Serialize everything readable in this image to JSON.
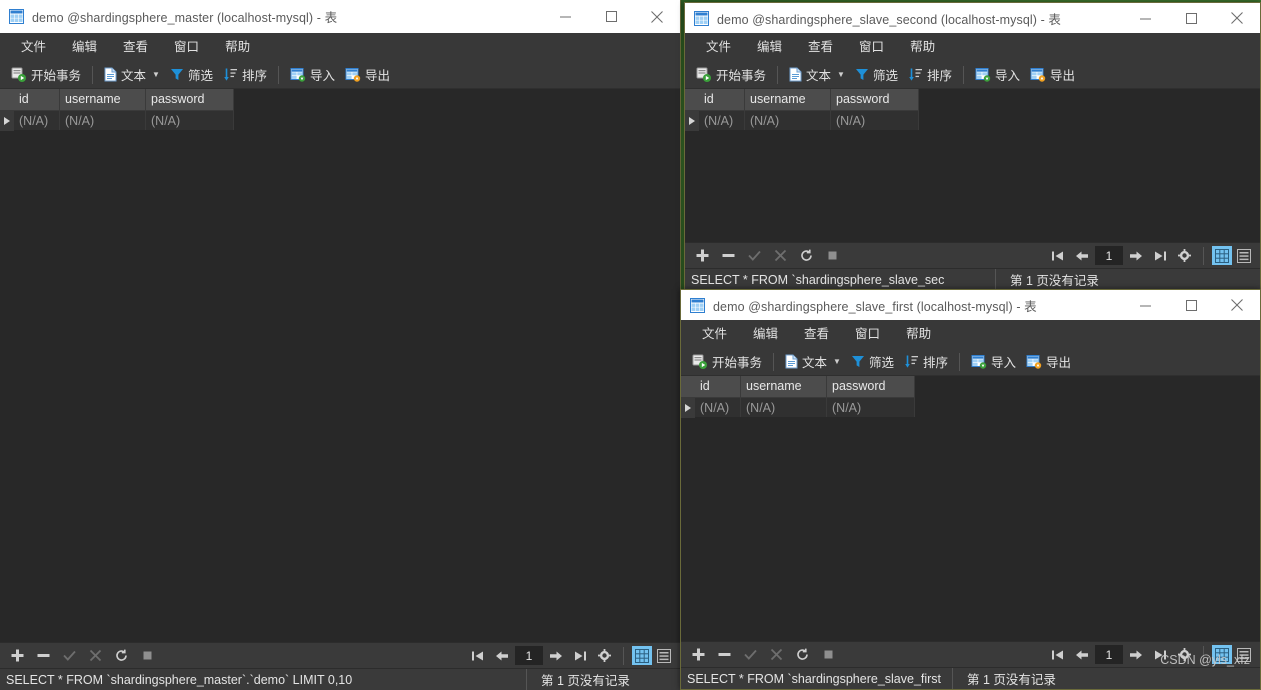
{
  "desktop": {
    "background_color": "#2f6b2a"
  },
  "common": {
    "menu": [
      "文件",
      "编辑",
      "查看",
      "窗口",
      "帮助"
    ],
    "toolbar": {
      "begin_transaction": "开始事务",
      "text": "文本",
      "filter": "筛选",
      "sort": "排序",
      "import": "导入",
      "export": "导出"
    },
    "grid": {
      "columns": [
        "id",
        "username",
        "password"
      ],
      "rows": [
        [
          "(N/A)",
          "(N/A)",
          "(N/A)"
        ]
      ]
    },
    "pagination": {
      "page": "1"
    },
    "titlebar_buttons": {
      "minimize": "minimize",
      "maximize": "maximize",
      "close": "close"
    },
    "accent_color": "#73c2f0"
  },
  "windows": [
    {
      "id": "master",
      "title": "demo @shardingsphere_master (localhost-mysql) - 表",
      "sql": "SELECT * FROM `shardingsphere_master`.`demo` LIMIT 0,10",
      "records": "第 1 页没有记录"
    },
    {
      "id": "slave_second",
      "title": "demo @shardingsphere_slave_second (localhost-mysql) - 表",
      "sql": "SELECT * FROM `shardingsphere_slave_sec",
      "records": "第 1 页没有记录"
    },
    {
      "id": "slave_first",
      "title": "demo @shardingsphere_slave_first (localhost-mysql) - 表",
      "sql": "SELECT * FROM `shardingsphere_slave_first",
      "records": "第 1 页没有记录"
    }
  ],
  "watermark": "CSDN @yls_xfz"
}
